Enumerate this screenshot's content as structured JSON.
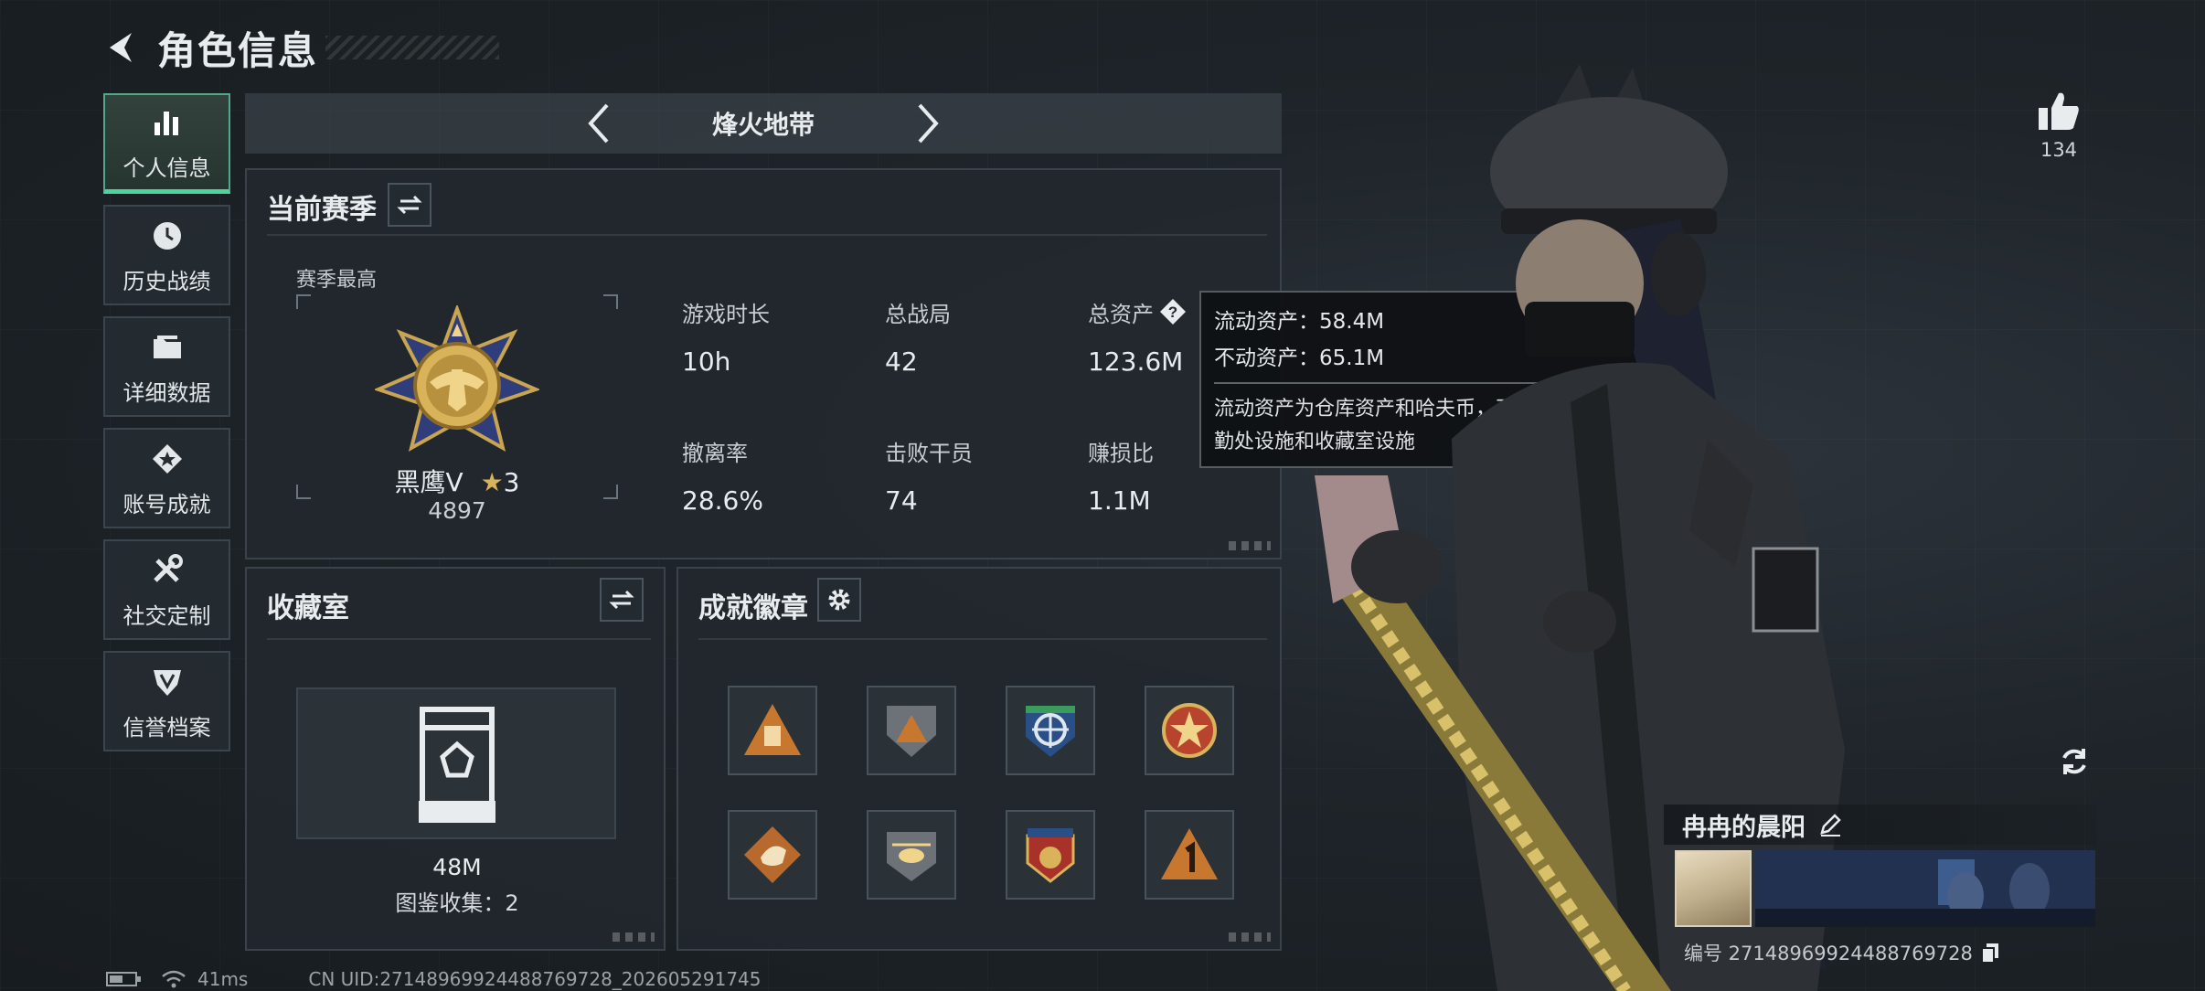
{
  "header": {
    "title": "角色信息"
  },
  "sidebar": {
    "items": [
      {
        "label": "个人信息",
        "icon": "bar-chart-icon",
        "active": true
      },
      {
        "label": "历史战绩",
        "icon": "history-clock-icon"
      },
      {
        "label": "详细数据",
        "icon": "folder-icon"
      },
      {
        "label": "账号成就",
        "icon": "achievement-star-icon"
      },
      {
        "label": "社交定制",
        "icon": "tools-icon"
      },
      {
        "label": "信誉档案",
        "icon": "shield-emblem-icon"
      }
    ]
  },
  "mode_bar": {
    "mode_name": "烽火地带"
  },
  "season": {
    "title": "当前赛季",
    "best_label": "赛季最高",
    "rank_name": "黑鹰Ⅴ",
    "rank_stars": "3",
    "rank_score": "4897",
    "stats": [
      {
        "label": "游戏时长",
        "value": "10h"
      },
      {
        "label": "总战局",
        "value": "42"
      },
      {
        "label": "总资产",
        "value": "123.6M"
      },
      {
        "label": "撤离率",
        "value": "28.6%"
      },
      {
        "label": "击败干员",
        "value": "74"
      },
      {
        "label": "赚损比",
        "value": "1.1M"
      }
    ]
  },
  "tooltip": {
    "liquid": "流动资产：58.4M",
    "fixed": "不动资产：65.1M",
    "description": "流动资产为仓库资产和哈夫币，不动资产为特勤处设施和收藏室设施"
  },
  "collection": {
    "title": "收藏室",
    "value": "48M",
    "count_text": "图鉴收集：2"
  },
  "badges": {
    "title": "成就徽章",
    "items": [
      {
        "icon": "triangle-supply-badge-icon",
        "color": "#c8782e"
      },
      {
        "icon": "shield-mountain-badge-icon",
        "color": "#8a8f94"
      },
      {
        "icon": "crosshair-badge-icon",
        "color": "#3b6fb3"
      },
      {
        "icon": "star-circle-badge-icon",
        "color": "#c8542e"
      },
      {
        "icon": "tiger-diamond-badge-icon",
        "color": "#c8782e"
      },
      {
        "icon": "helicopter-badge-icon",
        "color": "#8a8f94"
      },
      {
        "icon": "stars-shield-badge-icon",
        "color": "#b8362e"
      },
      {
        "icon": "number-one-triangle-badge-icon",
        "color": "#c8782e"
      }
    ]
  },
  "right": {
    "like_count": "134",
    "player_name": "冉冉的晨阳",
    "player_id": "编号 2714896992448876972​8"
  },
  "status_bar": {
    "latency": "41ms",
    "uid": "CN UID:2714896992448876972​8_202605291745"
  },
  "colors": {
    "accent": "#4bd49b",
    "panel_bg": "#22282d",
    "gold": "#d9b35a"
  }
}
